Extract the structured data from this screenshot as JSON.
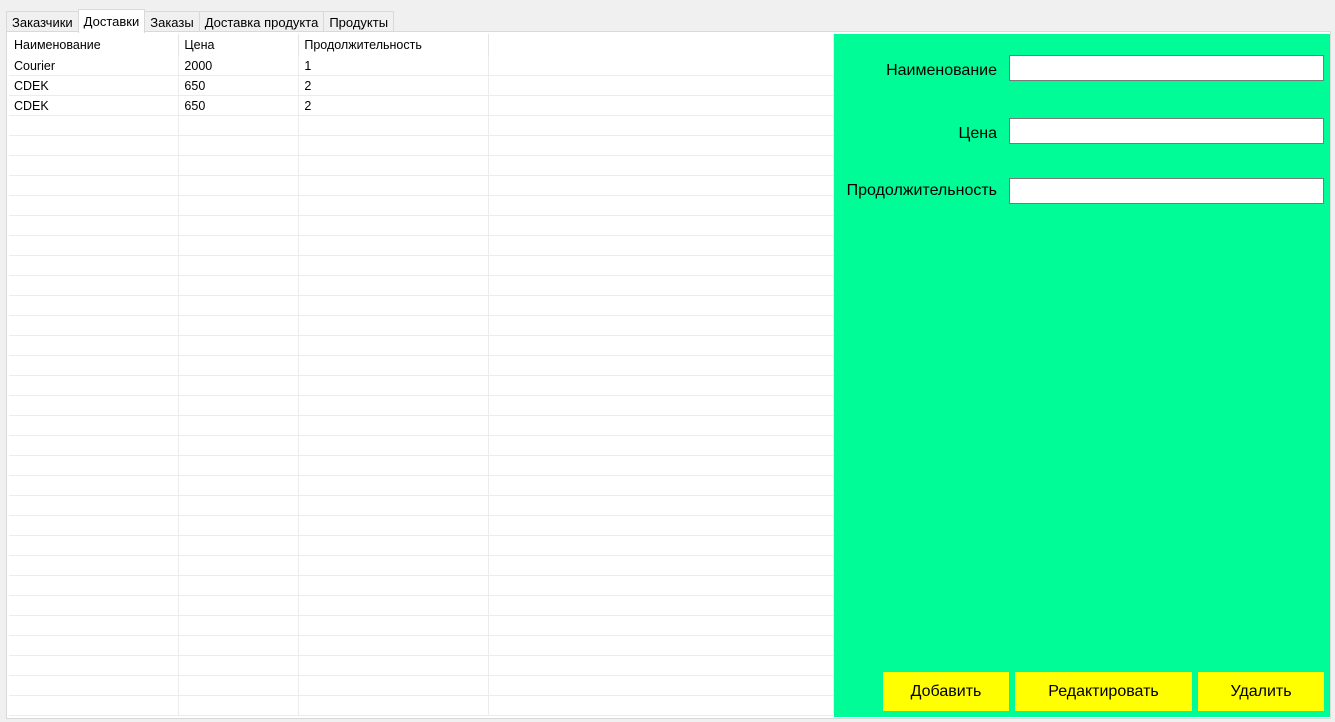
{
  "tabs": [
    {
      "label": "Заказчики",
      "active": false
    },
    {
      "label": "Доставки",
      "active": true
    },
    {
      "label": "Заказы",
      "active": false
    },
    {
      "label": "Доставка продукта",
      "active": false
    },
    {
      "label": "Продукты",
      "active": false
    }
  ],
  "grid": {
    "columns": [
      "Наименование",
      "Цена",
      "Продолжительность"
    ],
    "rows": [
      [
        "Courier",
        "2000",
        "1"
      ],
      [
        "CDEK",
        "650",
        "2"
      ],
      [
        "CDEK",
        "650",
        "2"
      ]
    ]
  },
  "form": {
    "name_label": "Наименование",
    "name_value": "",
    "price_label": "Цена",
    "price_value": "",
    "duration_label": "Продолжительность",
    "duration_value": ""
  },
  "buttons": {
    "add_label": "Добавить",
    "edit_label": "Редактировать",
    "delete_label": "Удалить"
  },
  "colors": {
    "panel_background": "#00fc97",
    "button_background": "#ffff00"
  }
}
